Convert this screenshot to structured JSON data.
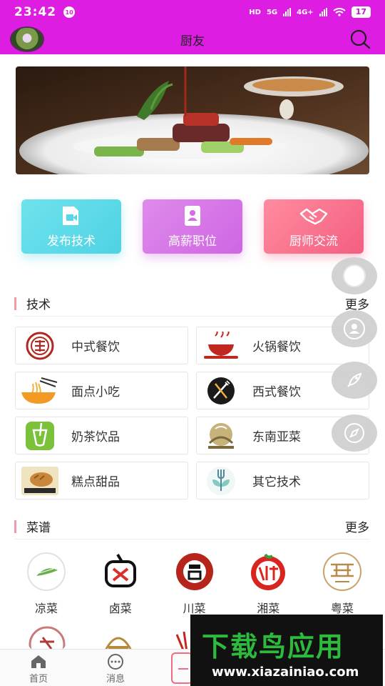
{
  "status_bar": {
    "time": "23:42",
    "notification_badge": "10",
    "network_labels": [
      "HD",
      "5G",
      "4G+"
    ],
    "battery": "17"
  },
  "header": {
    "title": "厨友",
    "icons": [
      "avatar",
      "search-icon"
    ]
  },
  "categories": [
    {
      "label": "发布技术",
      "icon": "video-icon",
      "color": "#56d6e6"
    },
    {
      "label": "高薪职位",
      "icon": "contact-book-icon",
      "color": "#d46be4"
    },
    {
      "label": "厨师交流",
      "icon": "handshake-icon",
      "color": "#f56585"
    }
  ],
  "tech_section": {
    "title": "技术",
    "more": "更多",
    "items": [
      {
        "label": "中式餐饮",
        "icon": "chinese-cuisine-icon"
      },
      {
        "label": "火锅餐饮",
        "icon": "hotpot-icon"
      },
      {
        "label": "面点小吃",
        "icon": "noodles-icon"
      },
      {
        "label": "西式餐饮",
        "icon": "western-cuisine-icon"
      },
      {
        "label": "奶茶饮品",
        "icon": "milk-tea-icon"
      },
      {
        "label": "东南亚菜",
        "icon": "southeast-asian-icon"
      },
      {
        "label": "糕点甜品",
        "icon": "bakery-icon"
      },
      {
        "label": "其它技术",
        "icon": "other-tech-icon"
      }
    ]
  },
  "recipe_section": {
    "title": "菜谱",
    "more": "更多",
    "items": [
      {
        "label": "凉菜",
        "icon": "cold-dish-icon"
      },
      {
        "label": "卤菜",
        "icon": "braised-dish-icon"
      },
      {
        "label": "川菜",
        "icon": "sichuan-dish-icon"
      },
      {
        "label": "湘菜",
        "icon": "hunan-dish-icon"
      },
      {
        "label": "粤菜",
        "icon": "cantonese-dish-icon"
      }
    ]
  },
  "tab_bar": {
    "tabs": [
      {
        "label": "首页",
        "icon": "home-icon"
      },
      {
        "label": "消息",
        "icon": "message-icon"
      }
    ]
  },
  "watermark": {
    "title": "下载鸟应用",
    "url": "www.xiazainiao.com"
  },
  "floating_buttons": [
    "circle-icon",
    "user-icon",
    "rocket-icon",
    "compass-icon"
  ]
}
